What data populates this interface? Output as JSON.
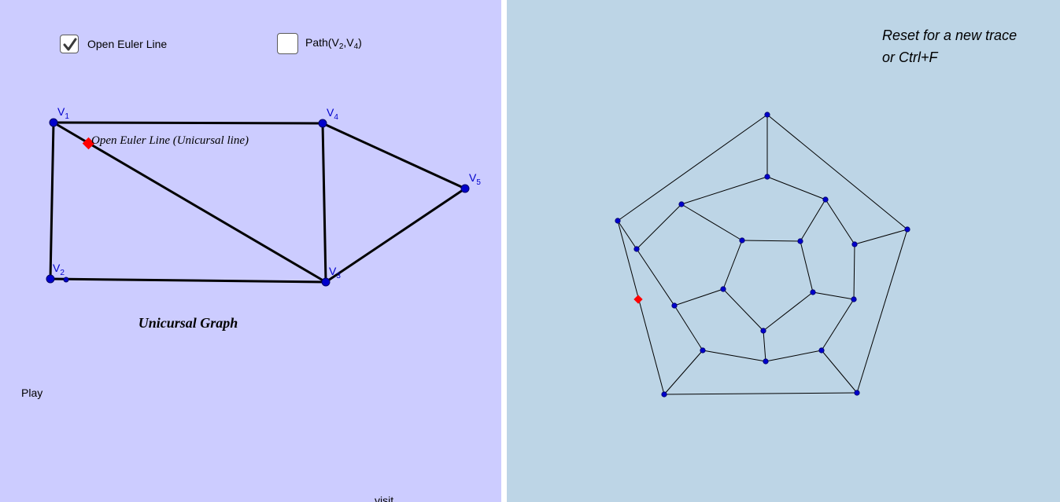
{
  "controls": {
    "euler_checkbox": {
      "checked": true,
      "label": "Open Euler Line"
    },
    "path_checkbox": {
      "checked": false,
      "label_prefix": "Path(V",
      "sub_a": "2",
      "label_sep": ",V",
      "sub_b": "4",
      "label_suffix": ")"
    }
  },
  "graph": {
    "vertices": [
      {
        "name": "V",
        "sub": "1"
      },
      {
        "name": "V",
        "sub": "2"
      },
      {
        "name": "V",
        "sub": "3"
      },
      {
        "name": "V",
        "sub": "4"
      },
      {
        "name": "V",
        "sub": "5"
      }
    ],
    "tracer_caption": "Open Euler Line (Unicursal line)",
    "title": "Unicursal Graph"
  },
  "play_label": "Play",
  "footer_link": "visit",
  "reset": {
    "line1": "Reset for a new trace",
    "line2": "or Ctrl+F"
  },
  "colors": {
    "left_bg": "#ccccff",
    "right_bg": "#bdd5e6",
    "vertex": "#0000cc",
    "tracer": "#ff0000",
    "edge": "#000000"
  }
}
